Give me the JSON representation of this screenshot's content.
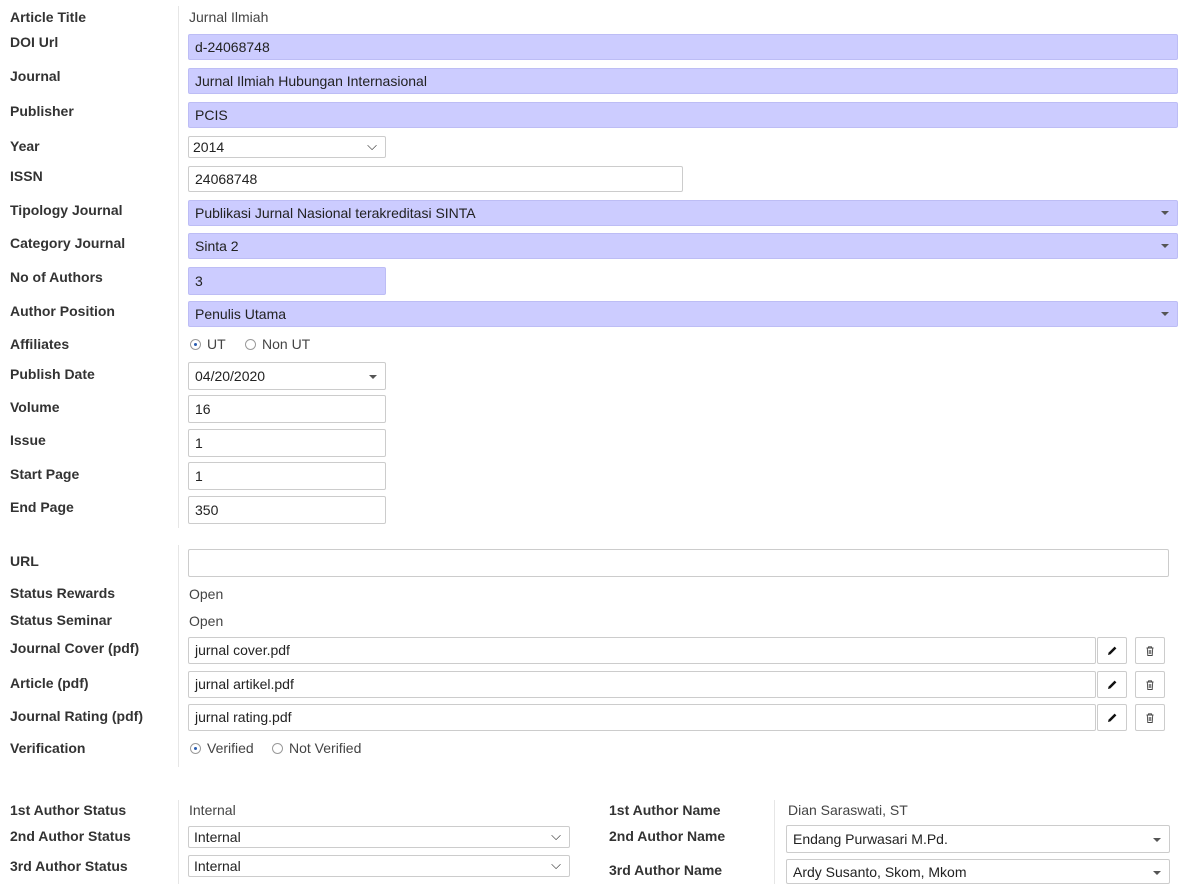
{
  "fields": {
    "article_title": {
      "label": "Article Title",
      "value": "Jurnal Ilmiah"
    },
    "doi_url": {
      "label": "DOI Url",
      "value": "d-24068748"
    },
    "journal": {
      "label": "Journal",
      "value": "Jurnal Ilmiah Hubungan Internasional"
    },
    "publisher": {
      "label": "Publisher",
      "value": "PCIS"
    },
    "year": {
      "label": "Year",
      "value": "2014"
    },
    "issn": {
      "label": "ISSN",
      "value": "24068748"
    },
    "tipology": {
      "label": "Tipology Journal",
      "value": "Publikasi Jurnal Nasional terakreditasi SINTA"
    },
    "category": {
      "label": "Category Journal",
      "value": "Sinta 2"
    },
    "no_authors": {
      "label": "No of Authors",
      "value": "3"
    },
    "author_position": {
      "label": "Author Position",
      "value": "Penulis Utama"
    },
    "affiliates": {
      "label": "Affiliates",
      "option1": "UT",
      "option2": "Non UT",
      "selected": "UT"
    },
    "publish_date": {
      "label": "Publish Date",
      "value": "04/20/2020"
    },
    "volume": {
      "label": "Volume",
      "value": "16"
    },
    "issue": {
      "label": "Issue",
      "value": "1"
    },
    "start_page": {
      "label": "Start Page",
      "value": "1"
    },
    "end_page": {
      "label": "End Page",
      "value": "350"
    }
  },
  "section2": {
    "url": {
      "label": "URL",
      "value": ""
    },
    "status_rewards": {
      "label": "Status Rewards",
      "value": "Open"
    },
    "status_seminar": {
      "label": "Status Seminar",
      "value": "Open"
    },
    "journal_cover": {
      "label": "Journal Cover (pdf)",
      "value": "jurnal cover.pdf"
    },
    "article": {
      "label": "Article (pdf)",
      "value": "jurnal artikel.pdf"
    },
    "journal_rating": {
      "label": "Journal Rating (pdf)",
      "value": "jurnal rating.pdf"
    },
    "verification": {
      "label": "Verification",
      "option1": "Verified",
      "option2": "Not Verified",
      "selected": "Verified"
    }
  },
  "authors": {
    "a1": {
      "status_label": "1st Author Status",
      "status": "Internal",
      "name_label": "1st Author Name",
      "name": "Dian Saraswati, ST"
    },
    "a2": {
      "status_label": "2nd Author Status",
      "status": "Internal",
      "name_label": "2nd Author Name",
      "name": "Endang Purwasari M.Pd."
    },
    "a3": {
      "status_label": "3rd Author Status",
      "status": "Internal",
      "name_label": "3rd Author Name",
      "name": "Ardy Susanto, Skom, Mkom"
    }
  },
  "icons": {
    "edit": "pencil-icon",
    "delete": "trash-icon",
    "dropdown": "caret-down-icon",
    "select": "chevron-down-icon"
  },
  "colors": {
    "highlight": "#ccccff",
    "border": "#cccccc",
    "label": "#333333"
  }
}
